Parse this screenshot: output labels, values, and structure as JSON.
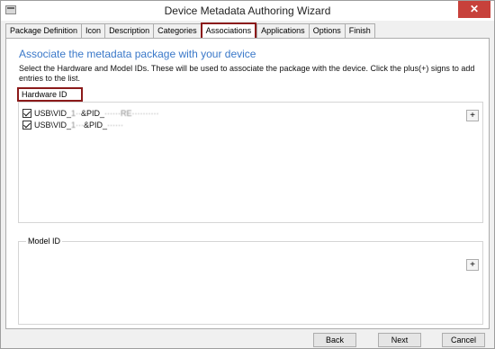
{
  "window": {
    "title": "Device Metadata Authoring Wizard",
    "close_glyph": "✕"
  },
  "tabs": [
    {
      "label": "Package Definition"
    },
    {
      "label": "Icon"
    },
    {
      "label": "Description"
    },
    {
      "label": "Categories"
    },
    {
      "label": "Associations",
      "active": true
    },
    {
      "label": "Applications"
    },
    {
      "label": "Options"
    },
    {
      "label": "Finish"
    }
  ],
  "associations": {
    "heading": "Associate the metadata package with your device",
    "description": "Select the Hardware and Model IDs. These will be used to associate the package with the device. Click the plus(+) signs to add entries to the list.",
    "hardware_id": {
      "label": "Hardware ID",
      "items": [
        {
          "prefix": "USB\\VID_",
          "obscured1": "1··",
          "mid": "&PID_",
          "obscured2": "······RE··········",
          "checked": true
        },
        {
          "prefix": "USB\\VID_",
          "obscured1": "1···",
          "mid": "&PID_",
          "obscured2": "······",
          "checked": true
        }
      ],
      "add_label": "+"
    },
    "model_id": {
      "label": "Model ID",
      "add_label": "+"
    }
  },
  "footer": {
    "back": "Back",
    "next": "Next",
    "cancel": "Cancel"
  },
  "colors": {
    "heading": "#3a78c9",
    "highlight_border": "#8b1a1a",
    "close_button": "#c7413b"
  }
}
